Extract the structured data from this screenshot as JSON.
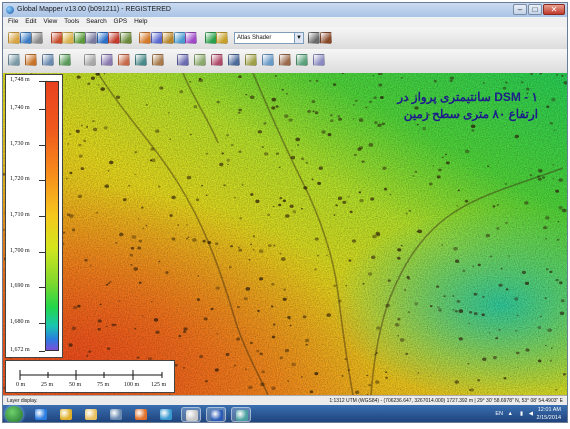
{
  "window": {
    "title": "Global Mapper v13.00 (b091211) - REGISTERED",
    "controls": [
      "–",
      "□",
      "✕"
    ]
  },
  "menu": [
    "File",
    "Edit",
    "View",
    "Tools",
    "Search",
    "GPS",
    "Help"
  ],
  "toolbar": {
    "shader_select": "Atlas Shader",
    "icon_colors_row1": [
      "#d9a441",
      "#3c7cc4",
      "#8a8a8a",
      "#c84c2c",
      "#d8b24a",
      "#5a9a3a",
      "#7a7aa0",
      "#2a6fc8",
      "#c43a2c",
      "#6a8a3a",
      "#d47a2a",
      "#5a6ad0",
      "#b8862a",
      "#4a9ad0",
      "#a04ac8",
      "#2aa04a",
      "#c8a02a",
      "#6a6a6a",
      "#8a4a2a"
    ],
    "icon_colors_row2": [
      "#7a9aa8",
      "#c8742a",
      "#6a8ab0",
      "#5a9a5a",
      "#a8a8a8",
      "#8a7ab0",
      "#c86a4a",
      "#4a8a8a",
      "#a87a4a",
      "#6a6ab0",
      "#8aa86a",
      "#b04a6a",
      "#4a6a9a",
      "#a0a04a",
      "#6a9ac8",
      "#9a6a4a",
      "#5aa07a",
      "#8a8ac0"
    ]
  },
  "legend": {
    "ticks": [
      "1,748 m",
      "1,740 m",
      "1,730 m",
      "1,720 m",
      "1,710 m",
      "1,700 m",
      "1,690 m",
      "1,680 m",
      "1,672 m"
    ],
    "tick_values": [
      1748,
      1740,
      1730,
      1720,
      1710,
      1700,
      1690,
      1680,
      1672
    ],
    "min_value": 1672,
    "max_value": 1748,
    "colors_top_to_bottom": [
      "#e8421f",
      "#f78f1b",
      "#f5c81c",
      "#d3e51d",
      "#7ed82c",
      "#22d64a",
      "#1ac6b0",
      "#2a7de0",
      "#7b4fd8"
    ]
  },
  "scalebar": {
    "labels": [
      "0 m",
      "25 m",
      "50 m",
      "75 m",
      "100 m",
      "125 m"
    ]
  },
  "annotation": {
    "line1": "DSM - ۱ سانتیمتری پرواز در",
    "line2": "ارتفاع ۸۰ متری سطح زمین"
  },
  "status": {
    "left": "Layer display.",
    "right": "1:1312 UTM (WGS84) - (706236.647, 3267014.000) 1727.392 m | 29° 30' 58.6978\" N, 53° 08' 54.4903\" E"
  },
  "taskbar": {
    "apps": [
      {
        "name": "ie",
        "color": "#2a7de0"
      },
      {
        "name": "chrome",
        "color": "#e0b02a"
      },
      {
        "name": "folder",
        "color": "#e8c060"
      },
      {
        "name": "media",
        "color": "#6a8ab0"
      },
      {
        "name": "firefox",
        "color": "#e0702a"
      },
      {
        "name": "globe",
        "color": "#3a9ad0"
      },
      {
        "name": "explorer",
        "color": "#c8c8c8"
      },
      {
        "name": "word",
        "color": "#2a5ab8"
      },
      {
        "name": "global-mapper",
        "color": "#4aa0a0"
      }
    ],
    "lang": "EN",
    "time": "12:01 AM",
    "date": "2/15/2014"
  }
}
